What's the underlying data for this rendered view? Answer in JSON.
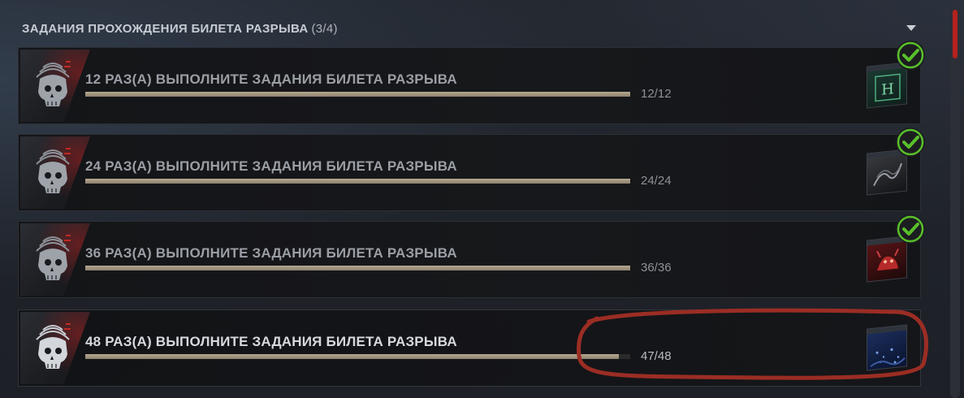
{
  "section": {
    "title": "ЗАДАНИЯ ПРОХОЖДЕНИЯ БИЛЕТА РАЗРЫВА",
    "count": "(3/4)"
  },
  "rows": [
    {
      "title": "12 РАЗ(А) ВЫПОЛНИТЕ ЗАДАНИЯ БИЛЕТА РАЗРЫВА",
      "progress_text": "12/12",
      "progress": 1.0,
      "completed": true,
      "reward_icon": "reward-green-h-icon"
    },
    {
      "title": "24 РАЗ(А) ВЫПОЛНИТЕ ЗАДАНИЯ БИЛЕТА РАЗРЫВА",
      "progress_text": "24/24",
      "progress": 1.0,
      "completed": true,
      "reward_icon": "reward-smoke-icon"
    },
    {
      "title": "36 РАЗ(А) ВЫПОЛНИТЕ ЗАДАНИЯ БИЛЕТА РАЗРЫВА",
      "progress_text": "36/36",
      "progress": 1.0,
      "completed": true,
      "reward_icon": "reward-red-creature-icon"
    },
    {
      "title": "48 РАЗ(А) ВЫПОЛНИТЕ ЗАДАНИЯ БИЛЕТА РАЗРЫВА",
      "progress_text": "47/48",
      "progress": 0.979,
      "completed": false,
      "reward_icon": "reward-blue-night-icon"
    }
  ],
  "colors": {
    "accent_red": "#b5221f",
    "check_green": "#58c02a",
    "progress_fill": "#b5a88f",
    "annotation_red": "#9b2d24"
  }
}
